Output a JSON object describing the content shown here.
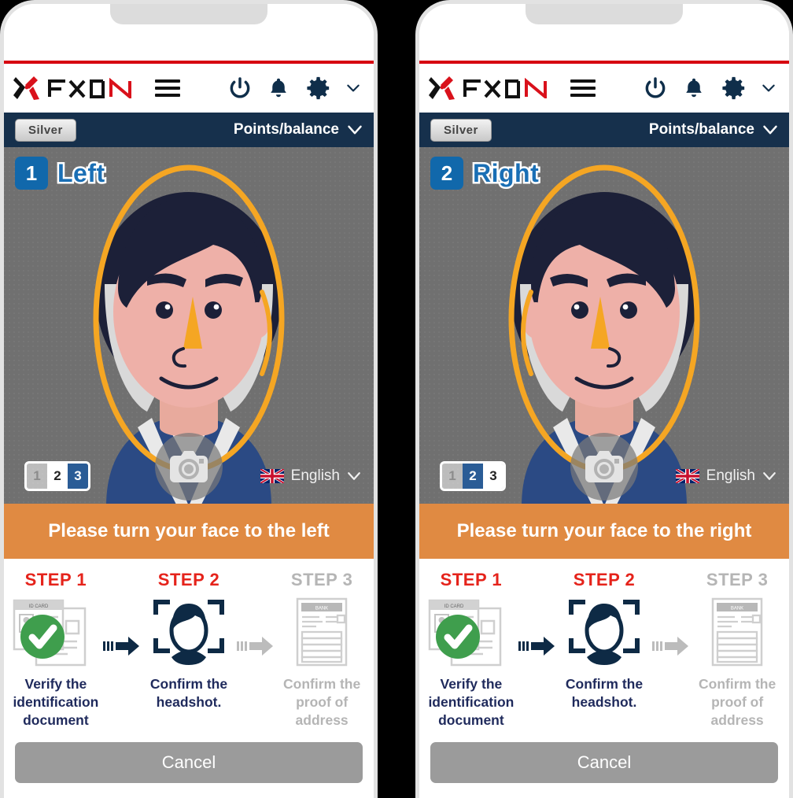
{
  "header": {
    "brand": "FXON",
    "menu_icon": "hamburger-icon",
    "power_icon": "power-icon",
    "bell_icon": "bell-icon",
    "gear_icon": "gear-icon",
    "chevron_icon": "chevron-down-icon"
  },
  "accountbar": {
    "rank": "Silver",
    "points_label": "Points/balance",
    "chevron": "⌄"
  },
  "colors": {
    "navy": "#16304c",
    "red_line": "#d60010",
    "banner_orange": "#e08a42",
    "step_active": "#e5231b",
    "step_inactive": "#b5b5b5",
    "label_navy": "#1f2a5c",
    "badge_blue": "#1168ab",
    "face_guide": "#f5a623",
    "check_green": "#3f9e4d",
    "cancel_grey": "#9b9b9b"
  },
  "camera": {
    "shutter_icon": "camera-icon",
    "language": "English",
    "flag": "uk-flag-icon",
    "language_chevron": "chevron-down-icon"
  },
  "phones": [
    {
      "step_number": "1",
      "step_label": "Left",
      "banner": "Please turn your face to the left",
      "mirrored": false,
      "pager": [
        {
          "text": "1",
          "state": "dim"
        },
        {
          "text": "2",
          "state": "plain"
        },
        {
          "text": "3",
          "state": "active"
        }
      ]
    },
    {
      "step_number": "2",
      "step_label": "Right",
      "banner": "Please turn your face to the right",
      "mirrored": true,
      "pager": [
        {
          "text": "1",
          "state": "dim"
        },
        {
          "text": "2",
          "state": "active"
        },
        {
          "text": "3",
          "state": "plain"
        }
      ]
    }
  ],
  "steps": [
    {
      "head": "STEP 1",
      "text": "Verify the identification document",
      "state": "on",
      "art": "id-card-verified-icon",
      "art_caption": "ID CARD"
    },
    {
      "head": "STEP 2",
      "text": "Confirm the headshot.",
      "state": "on",
      "art": "face-scan-icon",
      "art_caption": ""
    },
    {
      "head": "STEP 3",
      "text": "Confirm the proof of address",
      "state": "off",
      "art": "bank-document-icon",
      "art_caption": "BANK"
    }
  ],
  "footer": {
    "cancel_label": "Cancel"
  }
}
